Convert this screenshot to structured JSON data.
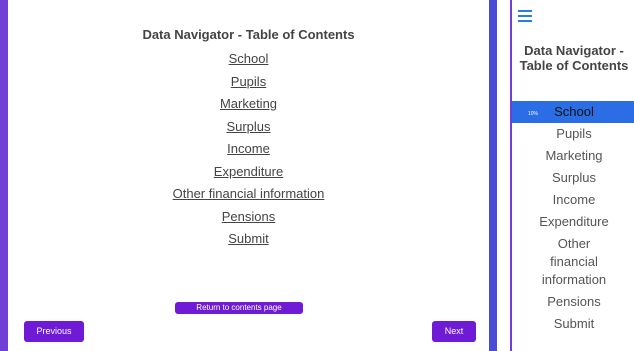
{
  "main": {
    "title": "Data Navigator - Table of Contents",
    "links": [
      "School",
      "Pupils",
      "Marketing",
      "Surplus",
      "Income",
      "Expenditure",
      "Other financial information",
      "Pensions",
      "Submit"
    ],
    "return_label": "Return to contents page",
    "previous_label": "Previous",
    "next_label": "Next"
  },
  "sidebar": {
    "title": "Data Navigator - Table of Contents",
    "active_percent": "10%",
    "items": [
      "School",
      "Pupils",
      "Marketing",
      "Surplus",
      "Income",
      "Expenditure",
      "Other financial information",
      "Pensions",
      "Submit"
    ]
  },
  "colors": {
    "accent": "#6f1bd6",
    "divider": "#4b4bd6",
    "active": "#2a6de5"
  }
}
